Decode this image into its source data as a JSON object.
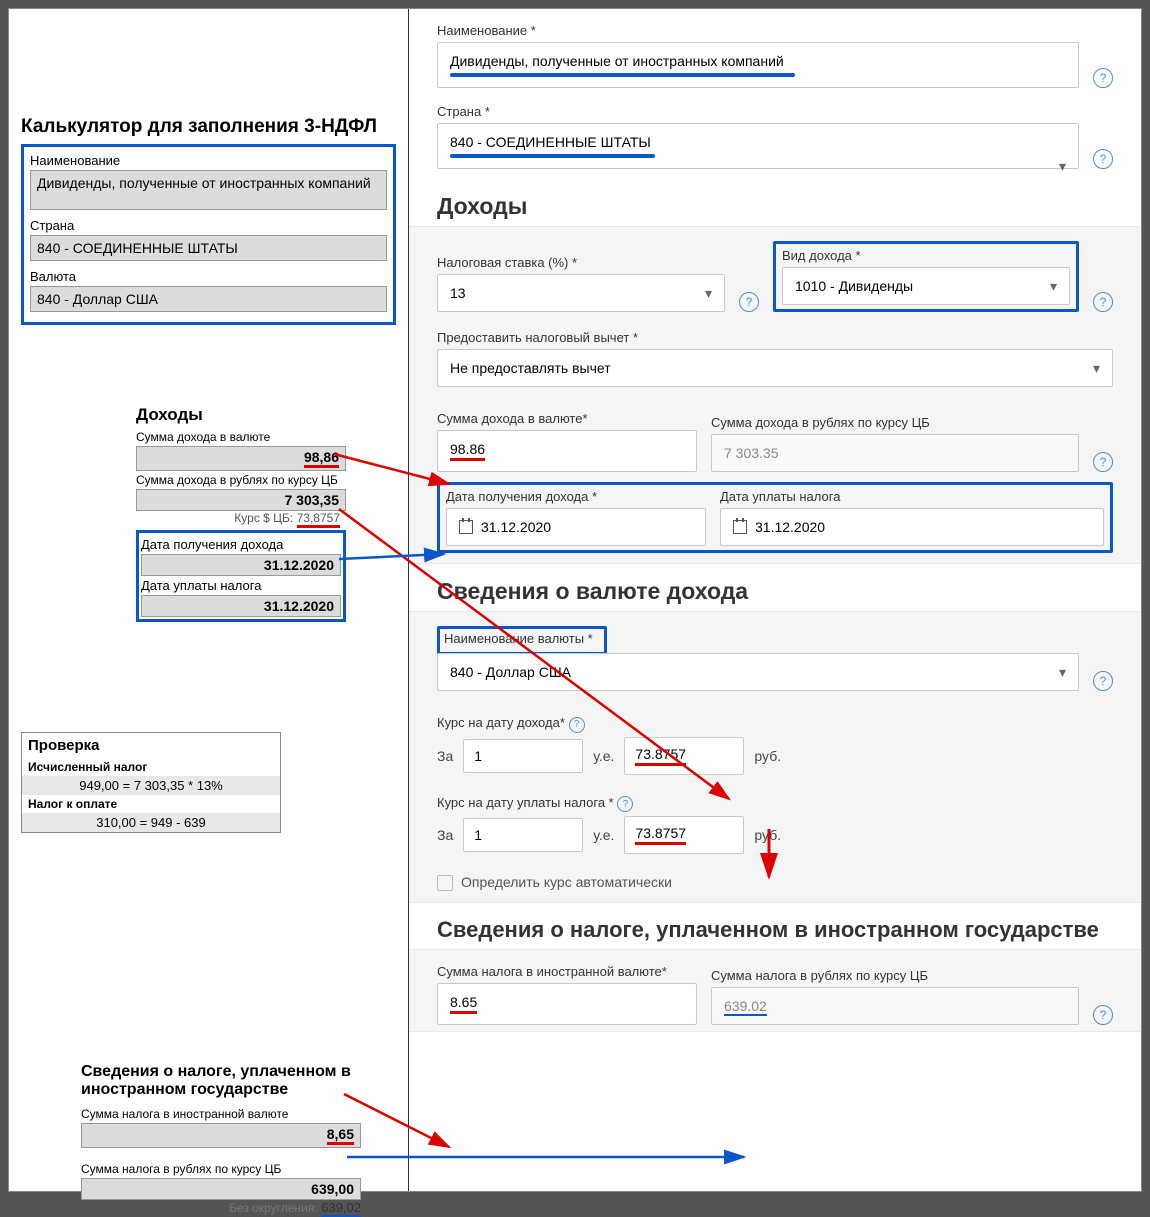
{
  "left": {
    "title": "Калькулятор для заполнения 3-НДФЛ",
    "name_label": "Наименование",
    "name_value": "Дивиденды, полученные от иностранных компаний",
    "country_label": "Страна",
    "country_value": "840 - СОЕДИНЕННЫЕ ШТАТЫ",
    "currency_label": "Валюта",
    "currency_value": "840 - Доллар США",
    "income_header": "Доходы",
    "sum_fx_label": "Сумма дохода в валюте",
    "sum_fx_value": "98,86",
    "sum_rub_label": "Сумма дохода в рублях по курсу ЦБ",
    "sum_rub_value": "7 303,35",
    "rate_label": "Курс $ ЦБ:",
    "rate_value": "73,8757",
    "date_inc_label": "Дата получения дохода",
    "date_inc_value": "31.12.2020",
    "date_tax_label": "Дата уплаты налога",
    "date_tax_value": "31.12.2020",
    "check_header": "Проверка",
    "calc_label": "Исчисленный налог",
    "calc_value": "949,00  =  7 303,35 * 13%",
    "pay_label": "Налог к оплате",
    "pay_value": "310,00  =  949 - 639",
    "ftax_header": "Сведения о налоге, уплаченном в иностранном государстве",
    "ftax_fx_label": "Сумма налога в иностранной валюте",
    "ftax_fx_value": "8,65",
    "ftax_rub_label": "Сумма налога в рублях по курсу ЦБ",
    "ftax_rub_value": "639,00",
    "ftax_noround_label": "Без округления:",
    "ftax_noround_value": "639,02"
  },
  "right": {
    "name_label": "Наименование *",
    "name_value": "Дивиденды, полученные от иностранных компаний",
    "country_label": "Страна *",
    "country_value": "840 - СОЕДИНЕННЫЕ ШТАТЫ",
    "income_header": "Доходы",
    "rate_label": "Налоговая ставка (%) *",
    "rate_value": "13",
    "type_label": "Вид дохода *",
    "type_value": "1010 - Дивиденды",
    "deduct_label": "Предоставить налоговый вычет *",
    "deduct_value": "Не предоставлять вычет",
    "sum_fx_label": "Сумма дохода в валюте*",
    "sum_fx_value": "98.86",
    "sum_rub_label": "Сумма дохода в рублях по курсу ЦБ",
    "sum_rub_value": "7 303.35",
    "date_inc_label": "Дата получения дохода *",
    "date_inc_value": "31.12.2020",
    "date_tax_label": "Дата уплаты налога",
    "date_tax_value": "31.12.2020",
    "cur_header": "Сведения о валюте дохода",
    "cur_label": "Наименование валюты *",
    "cur_value": "840 - Доллар США",
    "rate1_label": "Курс на дату дохода*",
    "rate2_label": "Курс на дату уплаты налога *",
    "za": "За",
    "one": "1",
    "ue": "у.е.",
    "rateval": "73.8757",
    "rub": "руб.",
    "auto_label": "Определить курс автоматически",
    "ftax_header": "Сведения о налоге, уплаченном в иностранном государстве",
    "ftax_fx_label": "Сумма налога в иностранной валюте*",
    "ftax_fx_value": "8.65",
    "ftax_rub_label": "Сумма налога в рублях по курсу ЦБ",
    "ftax_rub_value": "639.02"
  }
}
